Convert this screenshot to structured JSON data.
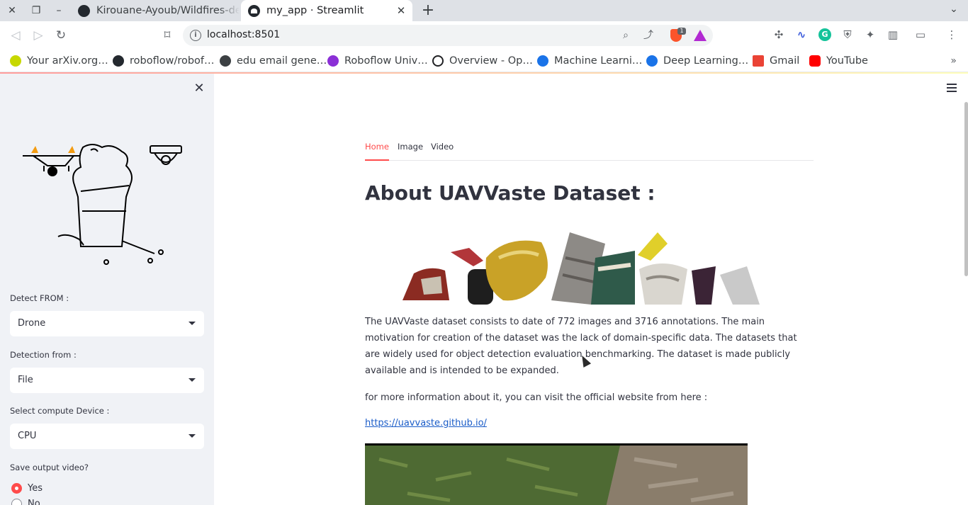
{
  "browser": {
    "tabs": [
      {
        "title": "Kirouane-Ayoub/Wildfires-de",
        "active": false
      },
      {
        "title": "my_app · Streamlit",
        "active": true
      }
    ],
    "url": "localhost:8501",
    "shield_count": "1",
    "bookmarks": [
      "Your arXiv.org…",
      "roboflow/robof…",
      "edu email gene…",
      "Roboflow Univ…",
      "Overview - Op…",
      "Machine Learni…",
      "Deep Learning…",
      "Gmail",
      "YouTube"
    ]
  },
  "sidebar": {
    "detect_from": {
      "label": "Detect FROM :",
      "value": "Drone"
    },
    "detection_from": {
      "label": "Detection from :",
      "value": "File"
    },
    "compute_device": {
      "label": "Select compute Device :",
      "value": "CPU"
    },
    "save_output": {
      "label": "Save output video?",
      "options": [
        "Yes",
        "No"
      ],
      "selected": "Yes"
    }
  },
  "main": {
    "tabs": [
      "Home",
      "Image",
      "Video"
    ],
    "active_tab": "Home",
    "heading": "About UAVVaste Dataset :",
    "paragraph1": "The UAVVaste dataset consists to date of 772 images and 3716 annotations. The main motivation for creation of the dataset was the lack of domain-specific data. The datasets that are widely used for object detection evaluation benchmarking. The dataset is made publicly available and is intended to be expanded.",
    "paragraph2": "for more information about it, you can visit the official website from here :",
    "link": "https://uavvaste.github.io/"
  },
  "colors": {
    "accent": "#ff4b4b",
    "sidebar_bg": "#f0f2f6",
    "link": "#1a5cc8",
    "text": "#31333f"
  }
}
